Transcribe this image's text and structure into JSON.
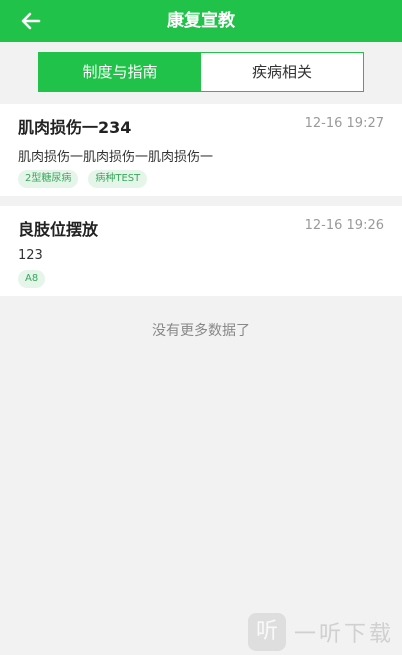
{
  "header": {
    "title": "康复宣教",
    "back_icon": "arrow-left-icon",
    "background": "#21c24a"
  },
  "tabs": [
    {
      "label": "制度与指南",
      "active": true
    },
    {
      "label": "疾病相关",
      "active": false
    }
  ],
  "items": [
    {
      "title": "肌肉损伤一234",
      "time": "12-16 19:27",
      "description": "肌肉损伤一肌肉损伤一肌肉损伤一",
      "tags": [
        "2型糖尿病",
        "病种TEST"
      ]
    },
    {
      "title": "良肢位摆放",
      "time": "12-16 19:26",
      "description": "123",
      "tags": [
        "A8"
      ]
    }
  ],
  "footer": {
    "no_more_text": "没有更多数据了"
  },
  "watermark": {
    "logo_glyph": "听",
    "text": "一听下载"
  },
  "colors": {
    "accent": "#21c24a",
    "tag_bg": "#e6f5ea",
    "tag_text": "#37a85a"
  }
}
